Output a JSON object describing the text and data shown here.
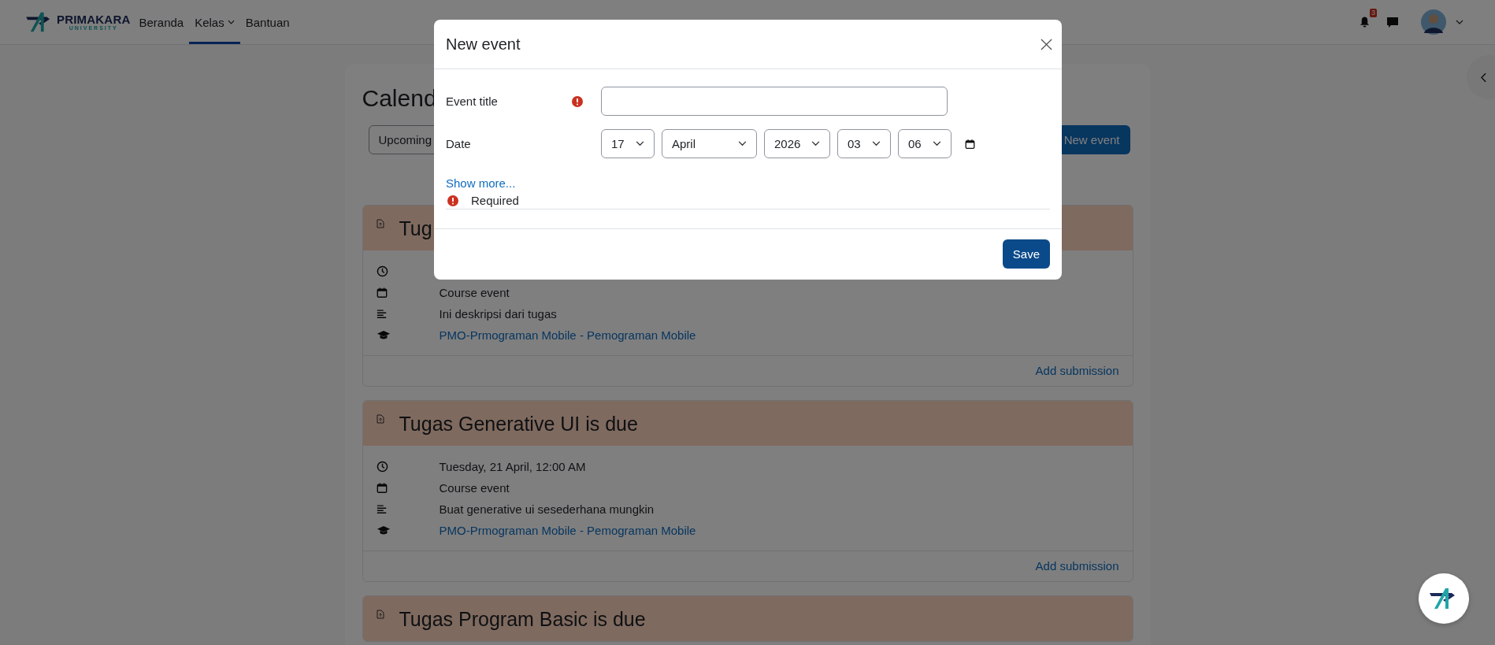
{
  "navbar": {
    "logo": {
      "name": "PRIMAKARA",
      "sub": "UNIVERSITY"
    },
    "links": [
      {
        "label": "Beranda",
        "selected": false,
        "dropdown": false
      },
      {
        "label": "Kelas",
        "selected": true,
        "dropdown": true
      },
      {
        "label": "Bantuan",
        "selected": false,
        "dropdown": false
      }
    ],
    "notification_count": "3"
  },
  "page": {
    "title": "Calend",
    "view_button": "Upcoming",
    "new_event_button": "New event"
  },
  "events": [
    {
      "title": "Tug",
      "details": [
        {
          "kind": "time"
        },
        {
          "kind": "type",
          "text": "Course event"
        },
        {
          "kind": "description",
          "text": "Ini deskripsi dari tugas"
        },
        {
          "kind": "course",
          "text": "PMO-Prmograman Mobile - Pemograman Mobile"
        }
      ],
      "action": "Add submission"
    },
    {
      "title": "Tugas Generative UI is due",
      "details": [
        {
          "kind": "time",
          "text": "Tuesday, 21 April, 12:00 AM"
        },
        {
          "kind": "type",
          "text": "Course event"
        },
        {
          "kind": "description",
          "text": "Buat generative ui sesederhana mungkin"
        },
        {
          "kind": "course",
          "text": "PMO-Prmograman Mobile - Pemograman Mobile"
        }
      ],
      "action": "Add submission"
    },
    {
      "title": "Tugas Program Basic is due"
    }
  ],
  "modal": {
    "title": "New event",
    "fields": [
      {
        "kind": "text",
        "label": "Event title",
        "required": true
      },
      {
        "kind": "date",
        "label": "Date",
        "required": false,
        "selects": [
          "17",
          "April",
          "2026",
          "03",
          "06"
        ]
      }
    ],
    "show_more": "Show more...",
    "required_note": "Required",
    "save_button": "Save"
  }
}
